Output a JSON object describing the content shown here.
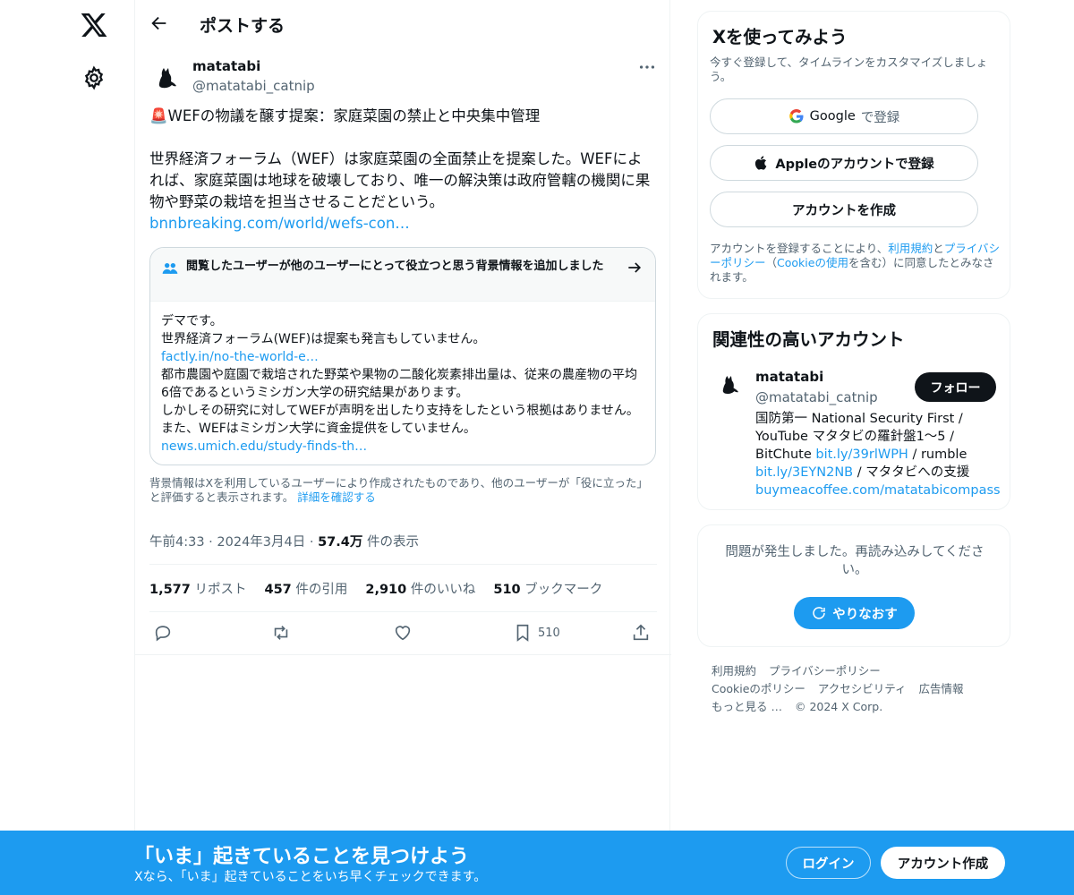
{
  "header": {
    "title": "ポストする"
  },
  "tweet": {
    "author_name": "matatabi",
    "author_handle": "@matatabi_catnip",
    "headline": "🚨WEFの物議を醸す提案：家庭菜園の禁止と中央集中管理",
    "body": "世界経済フォーラム（WEF）は家庭菜園の全面禁止を提案した。WEFによれば、家庭菜園は地球を破壊しており、唯一の解決策は政府管轄の機関に果物や野菜の栽培を担当させることだという。",
    "link": "bnnbreaking.com/world/wefs-con…",
    "time": "午前4:33",
    "date": "2024年3月4日",
    "views_count": "57.4万",
    "views_label": "件の表示",
    "stats": {
      "reposts_count": "1,577",
      "reposts_label": "リポスト",
      "quotes_count": "457",
      "quotes_label": "件の引用",
      "likes_count": "2,910",
      "likes_label": "件のいいね",
      "bookmarks_count": "510",
      "bookmarks_label": "ブックマーク"
    },
    "bookmark_action_count": "510"
  },
  "note": {
    "header": "閲覧したユーザーが他のユーザーにとって役立つと思う背景情報を追加しました",
    "line1": "デマです。",
    "line2": "世界経済フォーラム(WEF)は提案も発言もしていません。",
    "link1": "factly.in/no-the-world-e…",
    "line3": "都市農園や庭園で栽培された野菜や果物の二酸化炭素排出量は、従来の農産物の平均6倍であるというミシガン大学の研究結果があります。",
    "line4": "しかしその研究に対してWEFが声明を出したり支持をしたという根拠はありません。また、WEFはミシガン大学に資金提供をしていません。",
    "link2": "news.umich.edu/study-finds-th…",
    "footer": "背景情報はXを利用しているユーザーにより作成されたものであり、他のユーザーが「役に立った」と評価すると表示されます。",
    "footer_link": "詳細を確認する"
  },
  "signup": {
    "title": "Xを使ってみよう",
    "subtitle": "今すぐ登録して、タイムラインをカスタマイズしましょう。",
    "google_brand": "Google",
    "google_suffix": "で登録",
    "apple_label": "Appleのアカウントで登録",
    "create_label": "アカウントを作成",
    "terms_prefix": "アカウントを登録することにより、",
    "terms_link": "利用規約",
    "terms_and": "と",
    "privacy_link": "プライバシーポリシー",
    "terms_paren_open": "（",
    "cookie_link": "Cookieの使用",
    "terms_suffix": "を含む）に同意したとみなされます。"
  },
  "related": {
    "title": "関連性の高いアカウント",
    "name": "matatabi",
    "handle": "@matatabi_catnip",
    "follow_label": "フォロー",
    "bio_text": "国防第一 National Security First / YouTube マタタビの羅針盤1〜5 / BitChute ",
    "bio_link1": "bit.ly/39rlWPH",
    "bio_mid": " / rumble ",
    "bio_link2": "bit.ly/3EYN2NB",
    "bio_mid2": " / マタタビへの支援 ",
    "bio_link3": "buymeacoffee.com/matatabicompass"
  },
  "error": {
    "message": "問題が発生しました。再読み込みしてください。",
    "retry_label": "やりなおす"
  },
  "footer": {
    "links": [
      "利用規約",
      "プライバシーポリシー",
      "Cookieのポリシー",
      "アクセシビリティ",
      "広告情報",
      "もっと見る …",
      "© 2024 X Corp."
    ]
  },
  "banner": {
    "title": "「いま」起きていることを見つけよう",
    "subtitle": "Xなら、「いま」起きていることをいち早くチェックできます。",
    "login_label": "ログイン",
    "signup_label": "アカウント作成"
  },
  "colors": {
    "accent": "#1d9bf0",
    "text": "#0f1419",
    "muted": "#536471",
    "border": "#eff3f4"
  }
}
